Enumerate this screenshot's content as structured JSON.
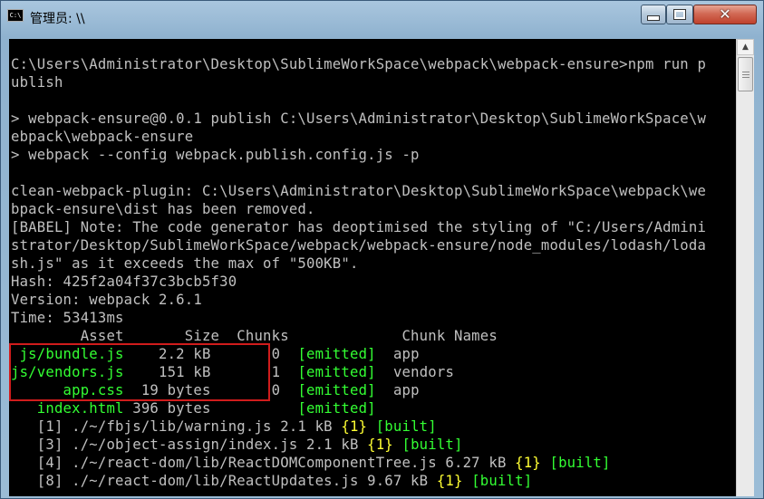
{
  "window": {
    "title": "管理员: \\\\",
    "icon_text": "C:\\"
  },
  "console": {
    "lines": [
      "C:\\Users\\Administrator\\Desktop\\SublimeWorkSpace\\webpack\\webpack-ensure>npm run p",
      "ublish",
      "",
      "> webpack-ensure@0.0.1 publish C:\\Users\\Administrator\\Desktop\\SublimeWorkSpace\\w",
      "ebpack\\webpack-ensure",
      "> webpack --config webpack.publish.config.js -p",
      "",
      "clean-webpack-plugin: C:\\Users\\Administrator\\Desktop\\SublimeWorkSpace\\webpack\\we",
      "bpack-ensure\\dist has been removed.",
      "[BABEL] Note: The code generator has deoptimised the styling of \"C:/Users/Admini",
      "strator/Desktop/SublimeWorkSpace/webpack/webpack-ensure/node_modules/lodash/loda",
      "sh.js\" as it exceeds the max of \"500KB\".",
      "Hash: 425f2a04f37c3bcb5f30",
      "Version: webpack 2.6.1",
      "Time: 53413ms"
    ],
    "table_header": "        Asset       Size  Chunks             Chunk Names",
    "assets": [
      {
        "name": " js/bundle.js",
        "size": "    2.2 kB",
        "chunk": "       0",
        "status": "[emitted]",
        "chunk_name": "app"
      },
      {
        "name": "js/vendors.js",
        "size": "    151 kB",
        "chunk": "       1",
        "status": "[emitted]",
        "chunk_name": "vendors"
      },
      {
        "name": "      app.css",
        "size": "  19 bytes",
        "chunk": "       0",
        "status": "[emitted]",
        "chunk_name": "app"
      },
      {
        "name": "   index.html",
        "size": " 396 bytes",
        "chunk": "        ",
        "status": "[emitted]",
        "chunk_name": ""
      }
    ],
    "modules": [
      {
        "id": "   [1] ./~/fbjs/lib/warning.js 2.1 kB ",
        "chunk": "{1}",
        "status": "[built]"
      },
      {
        "id": "   [3] ./~/object-assign/index.js 2.1 kB ",
        "chunk": "{1}",
        "status": "[built]"
      },
      {
        "id": "   [4] ./~/react-dom/lib/ReactDOMComponentTree.js 6.27 kB ",
        "chunk": "{1}",
        "status": "[built]"
      },
      {
        "id": "   [8] ./~/react-dom/lib/ReactUpdates.js 9.67 kB ",
        "chunk": "{1}",
        "status": "[built]"
      }
    ]
  }
}
